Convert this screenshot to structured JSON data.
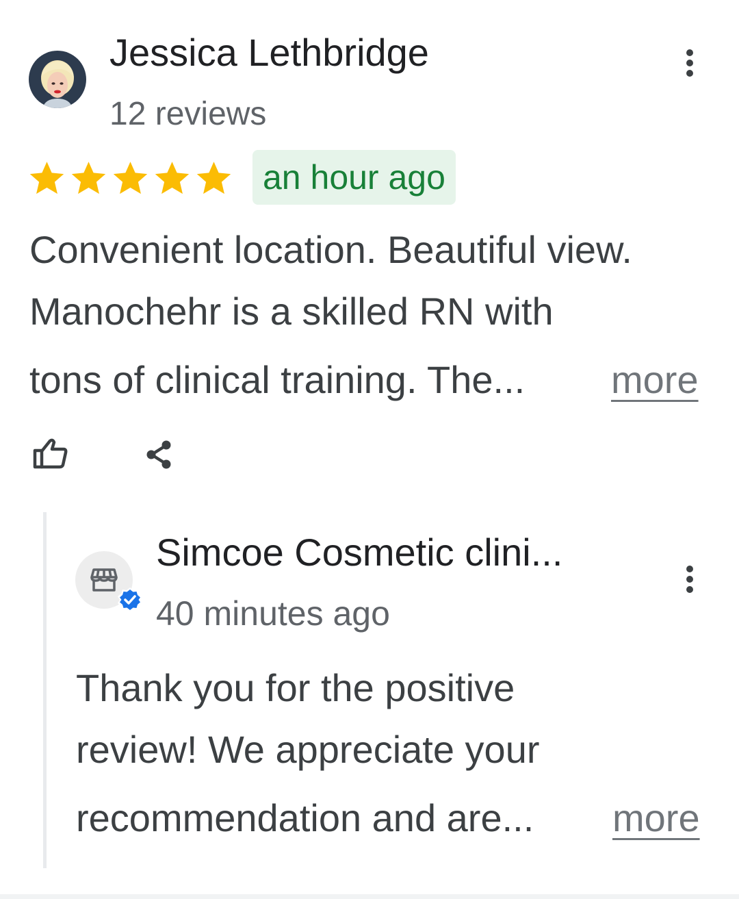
{
  "review": {
    "reviewer_name": "Jessica Lethbridge",
    "reviewer_count": "12 reviews",
    "rating": 5,
    "rating_max": 5,
    "time": "an hour ago",
    "text_lines": [
      "Convenient location. Beautiful view.",
      "Manochehr is a skilled RN with",
      "tons of clinical training. The..."
    ],
    "more_label": "more",
    "icons": {
      "menu": "more-vert-icon",
      "like": "thumb-up-icon",
      "share": "share-icon"
    }
  },
  "owner_reply": {
    "name": "Simcoe Cosmetic clini...",
    "time": "40 minutes ago",
    "text_lines": [
      "Thank you for the positive",
      "review! We appreciate your",
      "recommendation and are..."
    ],
    "more_label": "more",
    "icons": {
      "avatar": "storefront-icon",
      "badge": "verified-icon",
      "menu": "more-vert-icon"
    }
  },
  "colors": {
    "star": "#fbbc04",
    "time_badge_bg": "#e6f4ea",
    "time_badge_text": "#188038",
    "verified": "#1a73e8",
    "secondary_text": "#5f6368"
  }
}
